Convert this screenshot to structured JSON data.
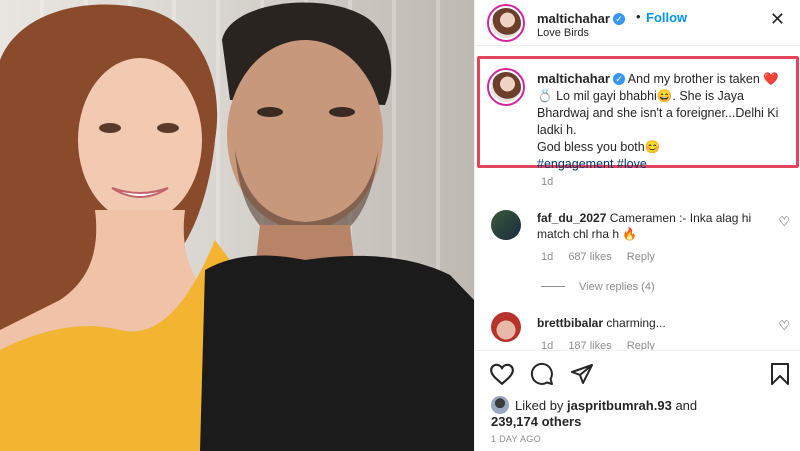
{
  "post": {
    "username": "maltichahar",
    "follow_label": "Follow",
    "dot": "•",
    "location": "Love Birds",
    "close_icon": "✕"
  },
  "caption": {
    "username": "maltichahar",
    "text_line1": "And my brother is taken",
    "text_emoji": "❤️💍",
    "text_line2": "Lo mil gayi bhabhi😄. She is Jaya Bhardwaj and she isn't a foreigner...Delhi Ki ladki h.",
    "text_line3": "God bless you both😊",
    "hashtags": "#engagement #love",
    "time": "1d"
  },
  "comments": [
    {
      "username": "faf_du_2027",
      "text": "Cameramen :- Inka alag hi match chl rha h 🔥",
      "time": "1d",
      "likes": "687 likes",
      "reply": "Reply",
      "view_replies": "View replies (4)"
    },
    {
      "username": "brettbibalar",
      "text": "charming...",
      "time": "1d",
      "likes": "187 likes",
      "reply": "Reply"
    }
  ],
  "likes_summary": {
    "prefix": "Liked by",
    "user": "jaspritbumrah.93",
    "middle": "and",
    "count": "239,174 others"
  },
  "post_time": "1 DAY AGO",
  "colors": {
    "highlight_border": "#e3455d",
    "link_blue": "#0095f6",
    "verified_blue": "#3897f0"
  },
  "icons": [
    "heart-icon",
    "comment-icon",
    "share-icon",
    "bookmark-icon",
    "verified-badge-icon",
    "close-icon"
  ]
}
